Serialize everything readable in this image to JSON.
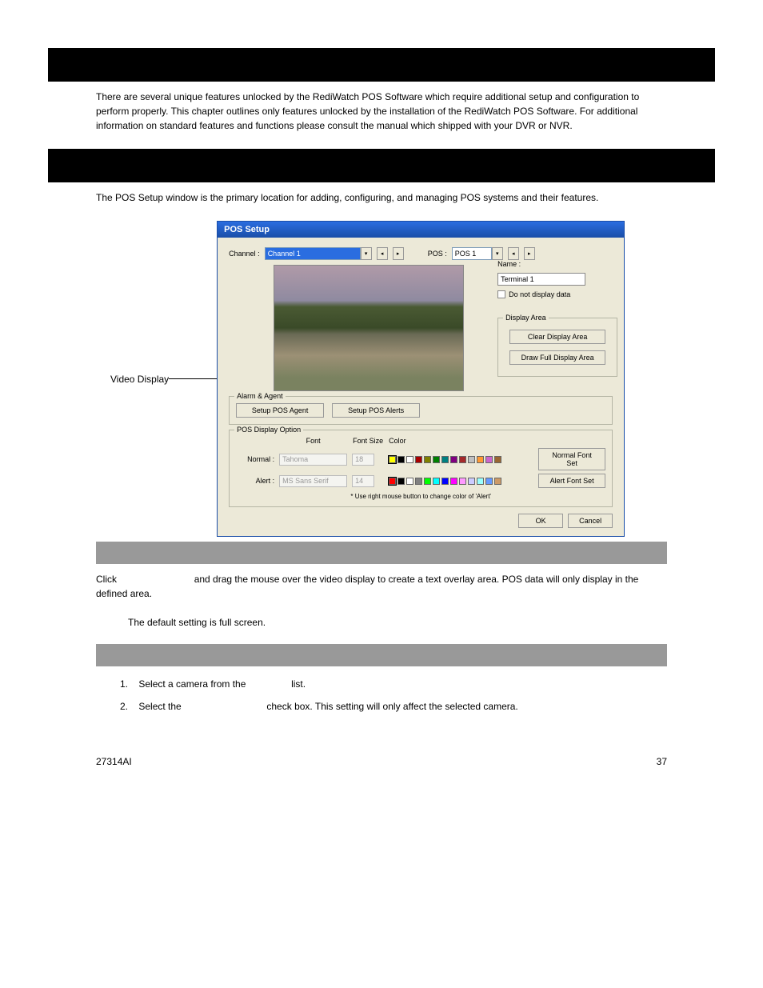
{
  "headers": {
    "setup": " ",
    "pos_setup": " "
  },
  "intro": "There are several unique features unlocked by the RediWatch POS Software which require additional setup and configuration to perform properly. This chapter outlines only features unlocked by the installation of the RediWatch POS Software. For additional information on standard features and functions please consult the manual which shipped with your DVR or NVR.",
  "pos_setup_intro": "The POS Setup window is the primary location for adding, configuring, and managing POS systems and their features.",
  "callout": {
    "video_display": "Video Display"
  },
  "dialog": {
    "title": "POS Setup",
    "channel_label": "Channel :",
    "channel_value": "Channel 1",
    "pos_label": "POS :",
    "pos_value": "POS 1",
    "name_label": "Name :",
    "name_value": "Terminal 1",
    "do_not_display": "Do not display data",
    "display_area": {
      "legend": "Display Area",
      "clear": "Clear Display Area",
      "draw_full": "Draw Full Display Area"
    },
    "alarm_agent": {
      "legend": "Alarm & Agent",
      "setup_agent": "Setup POS Agent",
      "setup_alerts": "Setup POS Alerts"
    },
    "pos_display": {
      "legend": "POS Display Option",
      "col_font": "Font",
      "col_size": "Font Size",
      "col_color": "Color",
      "normal_label": "Normal :",
      "normal_font": "Tahoma",
      "normal_size": "18",
      "normal_set_btn": "Normal Font Set",
      "alert_label": "Alert :",
      "alert_font": "MS Sans Serif",
      "alert_size": "14",
      "alert_set_btn": "Alert Font Set",
      "note": "* Use right mouse button to change color of 'Alert'",
      "colors_row1": [
        "#ffff00",
        "#000000",
        "#ffffff",
        "#aa0000",
        "#808000",
        "#008000",
        "#008080",
        "#800080",
        "#a52a2a",
        "#c0c0c0",
        "#ff9933",
        "#cc66cc",
        "#996633"
      ],
      "colors_row2": [
        "#ff0000",
        "#000000",
        "#ffffff",
        "#808080",
        "#00ff00",
        "#00ffff",
        "#0000ff",
        "#ff00ff",
        "#ff99ff",
        "#ccccff",
        "#99ffff",
        "#6699ff",
        "#cc9966"
      ]
    },
    "ok": "OK",
    "cancel": "Cancel"
  },
  "draw_area_heading": " ",
  "draw_area_text": {
    "prefix": "Click ",
    "suffix": " and drag the mouse over the video display to create a text overlay area.  POS data will only display in the defined area."
  },
  "draw_area_default": "The default setting is full screen.",
  "hide_heading": " ",
  "steps": [
    {
      "pre": "Select a camera from the ",
      "post": " list."
    },
    {
      "pre": "Select the ",
      "post": " check box.  This setting will only affect the selected camera."
    }
  ],
  "footer": {
    "left": "27314AI",
    "right": "37"
  }
}
